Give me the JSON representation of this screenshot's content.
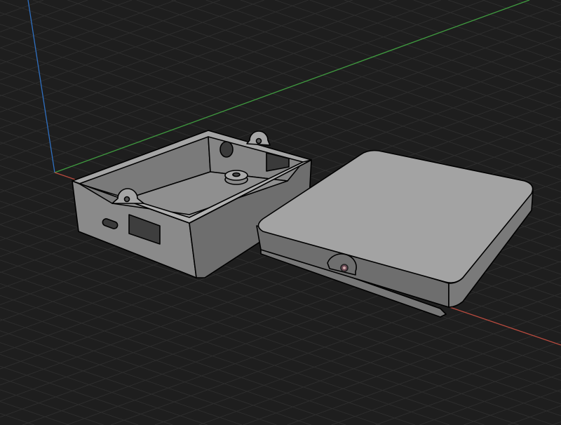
{
  "viewport": {
    "background_color": "#1e1e1e",
    "grid_color": "#2d2d2d",
    "axis_colors": {
      "x": "#b84a3e",
      "y": "#3f9a3f",
      "z": "#2f6fc0"
    },
    "model_face_color": "#9a9a9a",
    "model_edge_color": "#000000"
  }
}
